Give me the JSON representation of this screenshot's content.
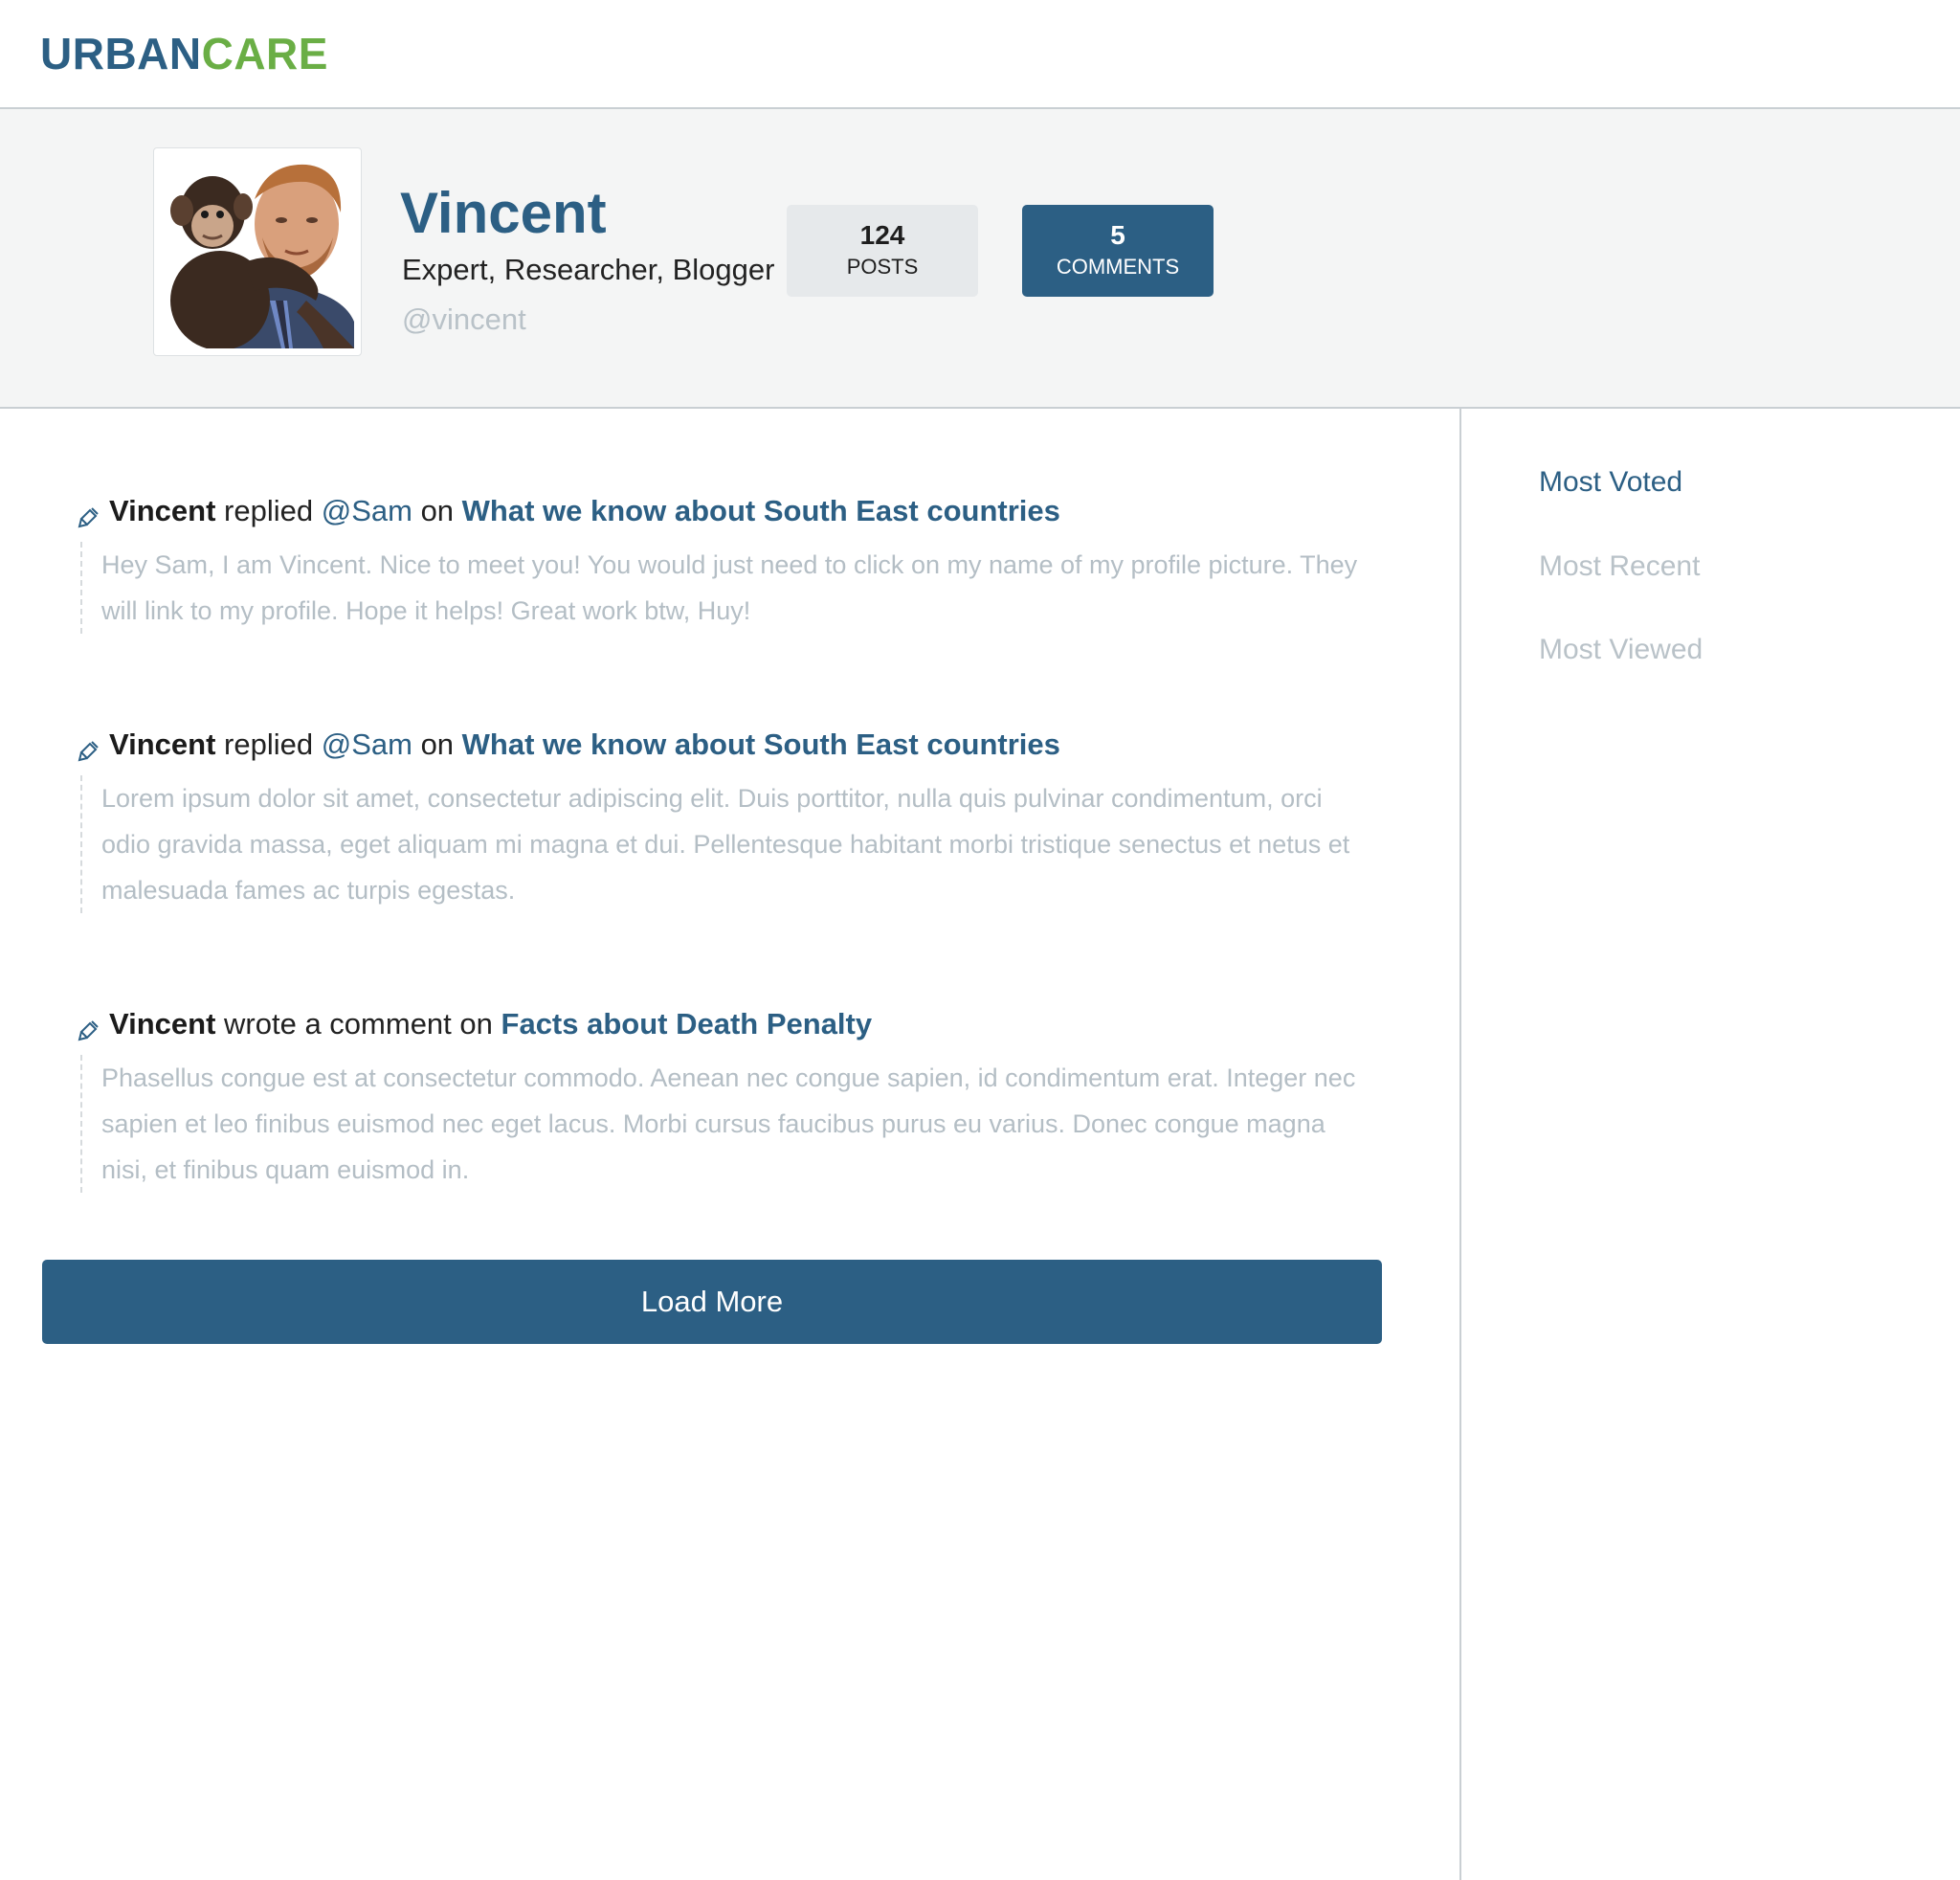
{
  "brand": {
    "part1": "URBAN",
    "part2": "CARE"
  },
  "profile": {
    "name": "Vincent",
    "roles": "Expert, Researcher, Blogger",
    "handle": "@vincent",
    "stats": {
      "posts": {
        "value": "124",
        "label": "POSTS"
      },
      "comments": {
        "value": "5",
        "label": "COMMENTS"
      }
    }
  },
  "activities": [
    {
      "user": "Vincent",
      "action": "replied",
      "mention": "@Sam",
      "connector": "on",
      "topic": "What we know about South East countries",
      "body": "Hey Sam, I am Vincent. Nice to meet you! You would just need to click on my name of my profile picture. They will link to my profile. Hope it helps! Great work btw, Huy!"
    },
    {
      "user": "Vincent",
      "action": "replied",
      "mention": "@Sam",
      "connector": "on",
      "topic": "What we know about South East countries",
      "body": "Lorem ipsum dolor sit amet, consectetur adipiscing elit. Duis porttitor, nulla quis pulvinar condimentum, orci odio gravida massa, eget aliquam mi magna et dui. Pellentesque habitant morbi tristique senectus et netus et malesuada fames ac turpis egestas."
    },
    {
      "user": "Vincent",
      "action": "wrote a comment on",
      "topic": "Facts about Death Penalty",
      "body": "Phasellus congue est at consectetur commodo. Aenean nec congue sapien, id condimentum erat. Integer nec sapien et leo finibus euismod nec eget lacus. Morbi cursus faucibus purus eu varius. Donec congue magna nisi, et finibus quam euismod in."
    }
  ],
  "load_more_label": "Load More",
  "sidebar": {
    "items": [
      {
        "label": "Most Voted",
        "active": true
      },
      {
        "label": "Most Recent",
        "active": false
      },
      {
        "label": "Most Viewed",
        "active": false
      }
    ]
  },
  "colors": {
    "brand_blue": "#2c5f84",
    "brand_green": "#6aae45",
    "muted_text": "#b4bec5"
  },
  "icons": {
    "activity": "pencil-edit-icon"
  }
}
